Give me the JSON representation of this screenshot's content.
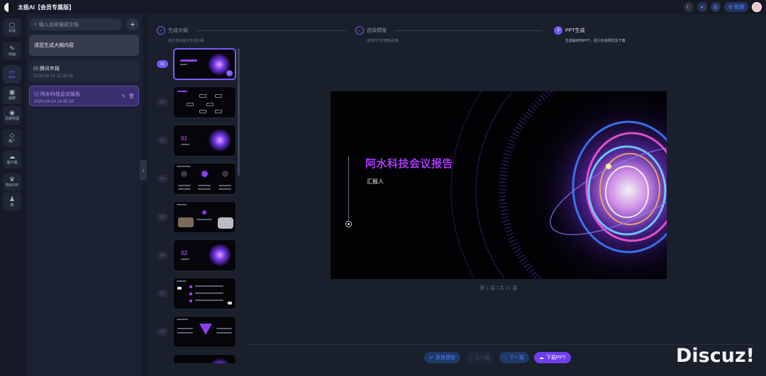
{
  "app": {
    "title": "太极AI【会员专属版】"
  },
  "topbar": {
    "manage_label": "管理"
  },
  "nav": [
    {
      "label": "对话",
      "icon": "chat-icon"
    },
    {
      "label": "绘画",
      "icon": "brush-icon"
    },
    {
      "label": "PPT",
      "icon": "ppt-icon"
    },
    {
      "label": "画廊",
      "icon": "gallery-icon"
    },
    {
      "label": "思维导图",
      "icon": "mindmap-icon"
    },
    {
      "label": "推广",
      "icon": "gem-icon"
    },
    {
      "label": "客户端",
      "icon": "cloud-icon"
    },
    {
      "label": "购买VIP",
      "icon": "crown-icon"
    },
    {
      "label": "我",
      "icon": "user-icon"
    }
  ],
  "sidebar": {
    "search_placeholder": "输入名称搜索文档",
    "new_doc_label": "请您生成大纲内容",
    "docs": [
      {
        "title": "腾讯年报",
        "date": "2025-04-14 15:25:49"
      },
      {
        "title": "阿水科技会议报告",
        "date": "2025-04-14 14:49:38"
      }
    ]
  },
  "steps": [
    {
      "name": "生成大纲",
      "desc": "通过您的提示生成大纲"
    },
    {
      "name": "选择模版",
      "desc": "选择PPT的模板风格"
    },
    {
      "name": "PPT生成",
      "desc": "生成最终的PPT，进行在线预览及下载",
      "num": "3"
    }
  ],
  "thumbnails": [
    "01",
    "02",
    "03",
    "04",
    "05",
    "06",
    "07",
    "08"
  ],
  "slide": {
    "title": "阿水科技会议报告",
    "subtitle": "汇报人"
  },
  "page_info": "第 1 篇 / 共 21 篇",
  "actions": {
    "change_template": "更换模版",
    "prev": "上一篇",
    "next": "下一篇",
    "download": "下载PPT"
  },
  "watermark": "Discuz!",
  "colors": {
    "accent": "#6d5cf0",
    "slide_title": "#a838f5",
    "background": "#1a1f2c"
  }
}
